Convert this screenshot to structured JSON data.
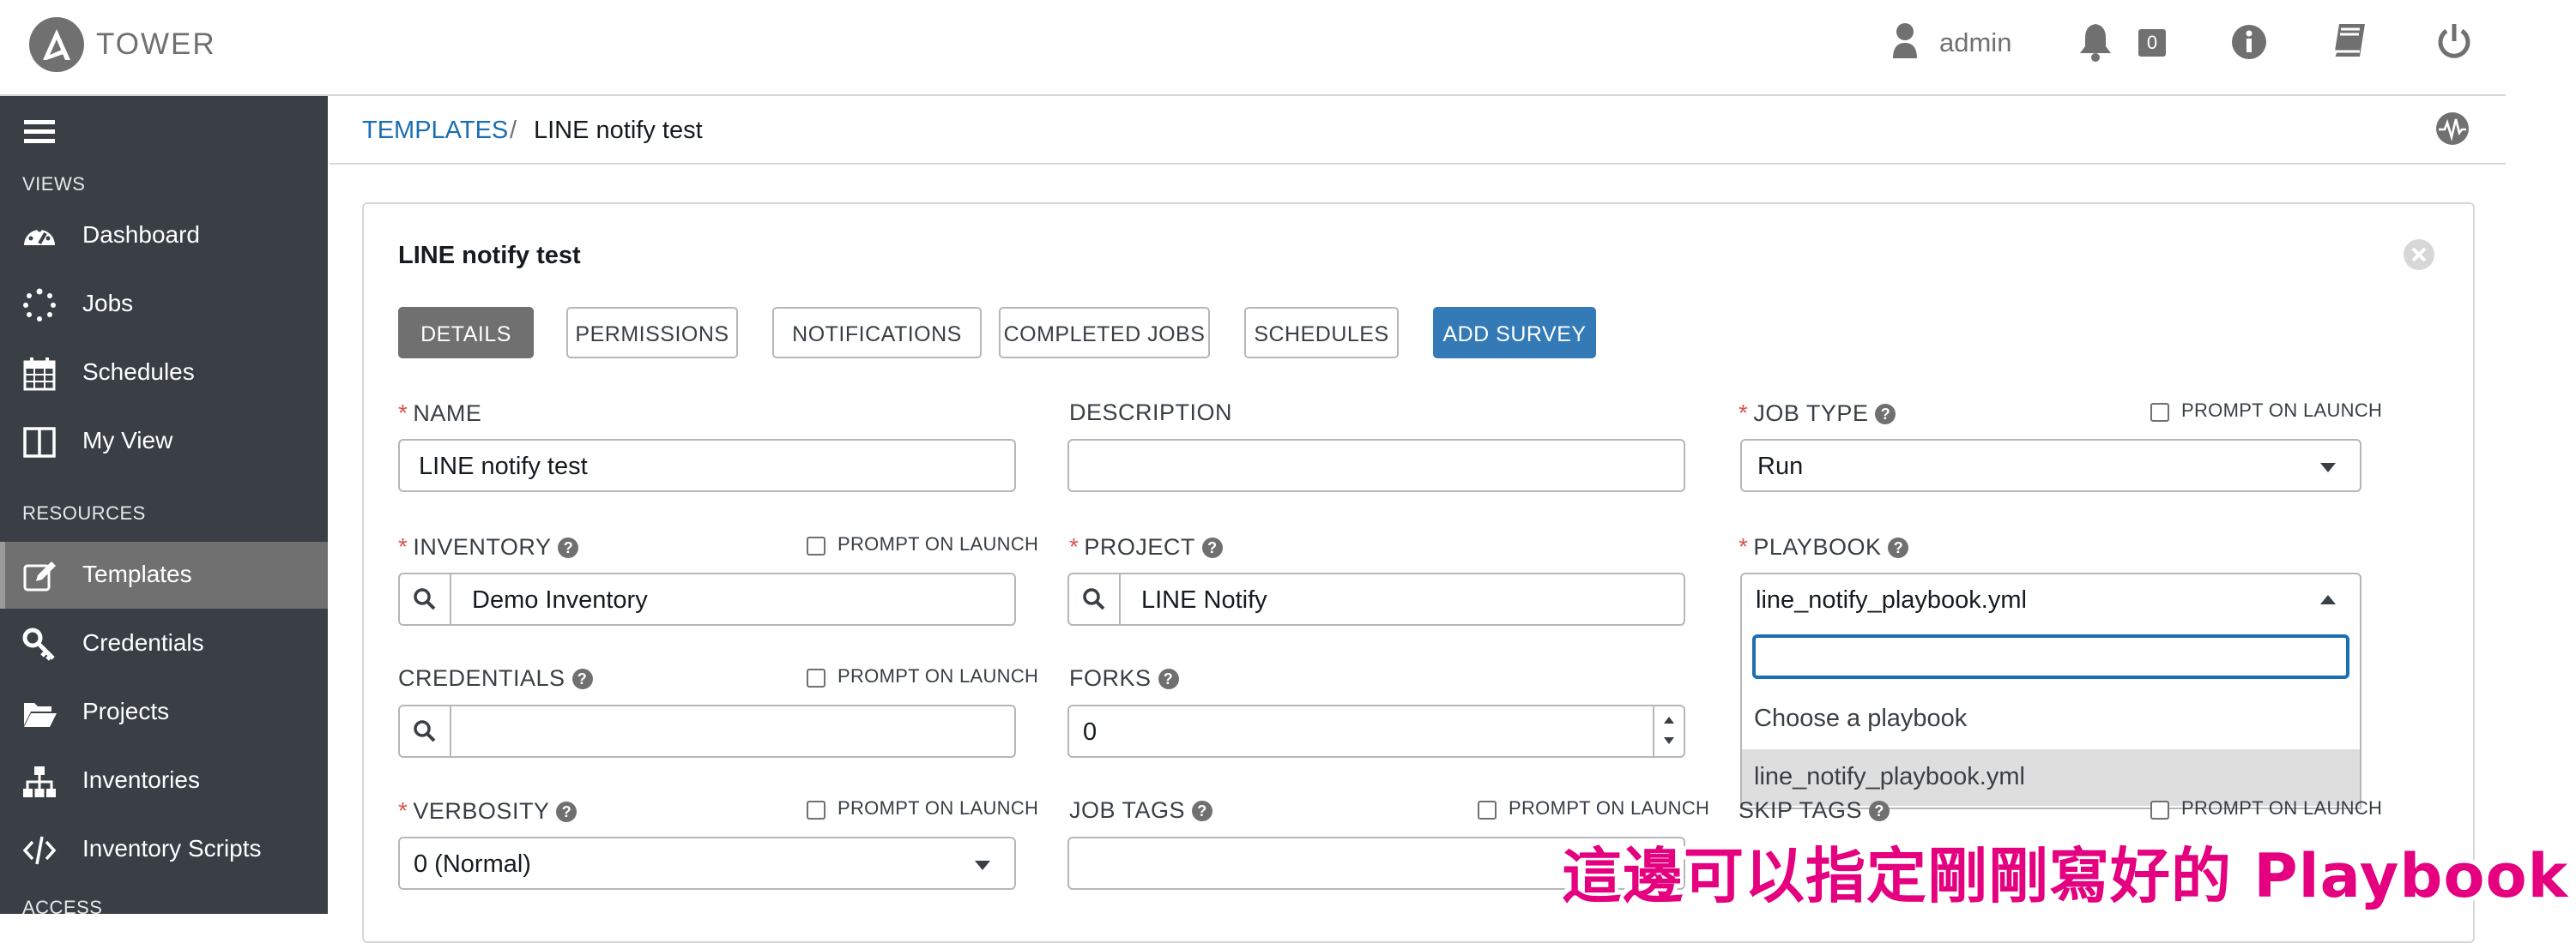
{
  "header": {
    "brand": "TOWER",
    "username": "admin",
    "notification_count": "0"
  },
  "sidebar": {
    "views_label": "VIEWS",
    "resources_label": "RESOURCES",
    "views": [
      {
        "label": "Dashboard",
        "icon": "dashboard-icon"
      },
      {
        "label": "Jobs",
        "icon": "jobs-spinner-icon"
      },
      {
        "label": "Schedules",
        "icon": "calendar-icon"
      },
      {
        "label": "My View",
        "icon": "columns-icon"
      }
    ],
    "resources": [
      {
        "label": "Templates",
        "icon": "edit-icon",
        "active": true
      },
      {
        "label": "Credentials",
        "icon": "key-icon"
      },
      {
        "label": "Projects",
        "icon": "folder-icon"
      },
      {
        "label": "Inventories",
        "icon": "sitemap-icon"
      },
      {
        "label": "Inventory Scripts",
        "icon": "code-icon"
      }
    ],
    "partial_label": "ACCESS"
  },
  "breadcrumb": {
    "parent": "TEMPLATES",
    "separator": "/",
    "current": "LINE notify test"
  },
  "panel": {
    "title": "LINE notify test",
    "tabs": [
      "DETAILS",
      "PERMISSIONS",
      "NOTIFICATIONS",
      "COMPLETED JOBS",
      "SCHEDULES",
      "ADD SURVEY"
    ]
  },
  "form": {
    "prompt_on_launch": "PROMPT ON LAUNCH",
    "name": {
      "label": "NAME",
      "value": "LINE notify test"
    },
    "description": {
      "label": "DESCRIPTION",
      "value": ""
    },
    "job_type": {
      "label": "JOB TYPE",
      "value": "Run"
    },
    "inventory": {
      "label": "INVENTORY",
      "value": "Demo Inventory"
    },
    "project": {
      "label": "PROJECT",
      "value": "LINE Notify"
    },
    "playbook": {
      "label": "PLAYBOOK",
      "value": "line_notify_playbook.yml",
      "search_value": "",
      "options": [
        "Choose a playbook",
        "line_notify_playbook.yml"
      ]
    },
    "credentials": {
      "label": "CREDENTIALS",
      "value": ""
    },
    "forks": {
      "label": "FORKS",
      "value": "0"
    },
    "verbosity": {
      "label": "VERBOSITY",
      "value": "0 (Normal)"
    },
    "job_tags": {
      "label": "JOB TAGS",
      "value": ""
    },
    "skip_tags": {
      "label": "SKIP TAGS"
    }
  },
  "annotation": "這邊可以指定剛剛寫好的 Playbook",
  "colors": {
    "sidebar_bg": "#393f44",
    "active_item": "#707070",
    "link": "#1a6eb3",
    "primary": "#337ab7",
    "required": "#d9534f",
    "annotation": "#e4007f"
  }
}
